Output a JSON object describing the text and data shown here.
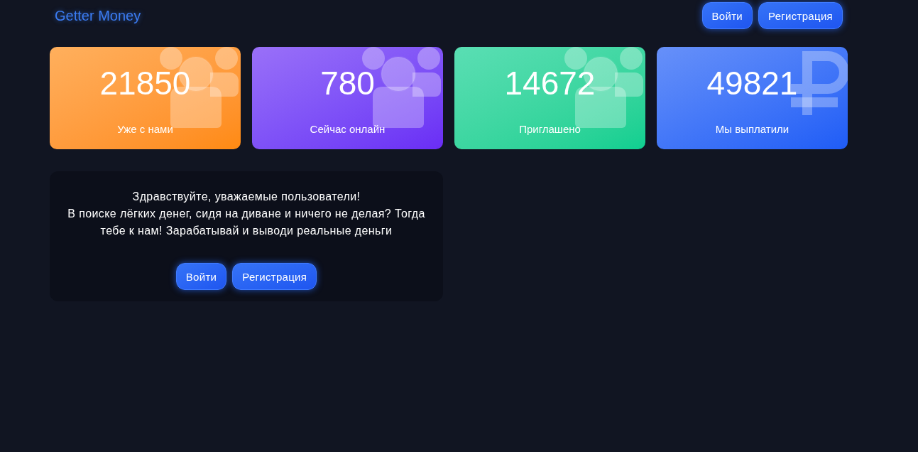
{
  "header": {
    "logo": "Getter Money",
    "buttons": [
      {
        "label": "Войти"
      },
      {
        "label": "Регистрация"
      }
    ]
  },
  "stats": [
    {
      "value": "21850",
      "label": "Уже с нами",
      "kind": "users",
      "color": "#ff8a10"
    },
    {
      "value": "780",
      "label": "Сейчас онлайн",
      "kind": "users",
      "color": "#6a2cf5"
    },
    {
      "value": "14672",
      "label": "Приглашено",
      "kind": "users",
      "color": "#0ccf90"
    },
    {
      "value": "49821",
      "label": "Мы выплатили",
      "kind": "ruble",
      "color": "#1f5cf6"
    }
  ],
  "welcome": {
    "greeting": "Здравствуйте, уважаемые пользователи!",
    "text": "В поиске лёгких денег, сидя на диване и ничего не делая? Тогда тебе к нам! Зарабатывай и выводи реальные деньги",
    "buttons": [
      {
        "label": "Войти"
      },
      {
        "label": "Регистрация"
      }
    ]
  }
}
